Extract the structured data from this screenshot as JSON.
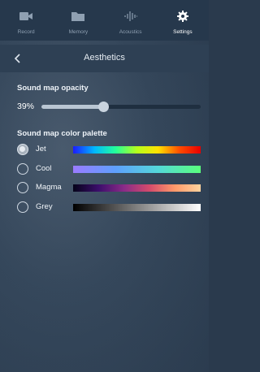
{
  "tabs": [
    {
      "label": "Record",
      "icon": "video-camera-icon"
    },
    {
      "label": "Memory",
      "icon": "folder-icon"
    },
    {
      "label": "Acoustics",
      "icon": "waveform-icon"
    },
    {
      "label": "Settings",
      "icon": "gear-icon",
      "active": true
    }
  ],
  "header": {
    "title": "Aesthetics",
    "back_icon": "chevron-left-icon"
  },
  "opacity": {
    "title": "Sound map opacity",
    "value_text": "39%",
    "value": 0.39
  },
  "palette": {
    "title": "Sound map color palette",
    "options": [
      {
        "label": "Jet",
        "selected": true,
        "colors": [
          "#1c1cff",
          "#00b7ff",
          "#24ff9a",
          "#b5ff1c",
          "#ffe100",
          "#ff4d00",
          "#e80000"
        ]
      },
      {
        "label": "Cool",
        "selected": false,
        "colors": [
          "#9a7bff",
          "#5ea0ff",
          "#54d7d9",
          "#59ff7c"
        ]
      },
      {
        "label": "Magma",
        "selected": false,
        "colors": [
          "#05031a",
          "#3c0e6b",
          "#8a2b88",
          "#d44b6b",
          "#ff9a6a",
          "#ffd39e"
        ]
      },
      {
        "label": "Grey",
        "selected": false,
        "colors": [
          "#000000",
          "#ffffff"
        ]
      }
    ]
  },
  "colors": {
    "tabbar": "#26384c",
    "subheader": "#2e4054",
    "accent": "#ffffff"
  }
}
